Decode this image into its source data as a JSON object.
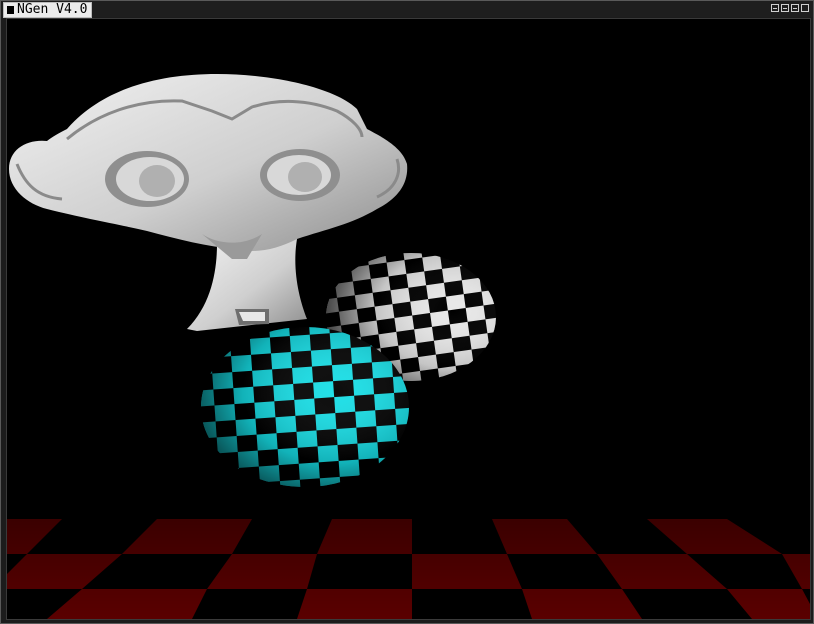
{
  "window": {
    "title": "NGen V4.0",
    "controls": [
      "minimize",
      "restore",
      "maximize",
      "close"
    ]
  },
  "scene": {
    "objects": [
      "monkey-head-model",
      "checkered-sphere-gray",
      "checkered-sphere-cyan",
      "checkered-floor"
    ],
    "colors": {
      "background": "#000000",
      "monkey": "#d8d8d8",
      "sphere_gray": "#e6e6e6",
      "sphere_cyan": "#17e0e8",
      "floor": "#5a0000"
    }
  }
}
